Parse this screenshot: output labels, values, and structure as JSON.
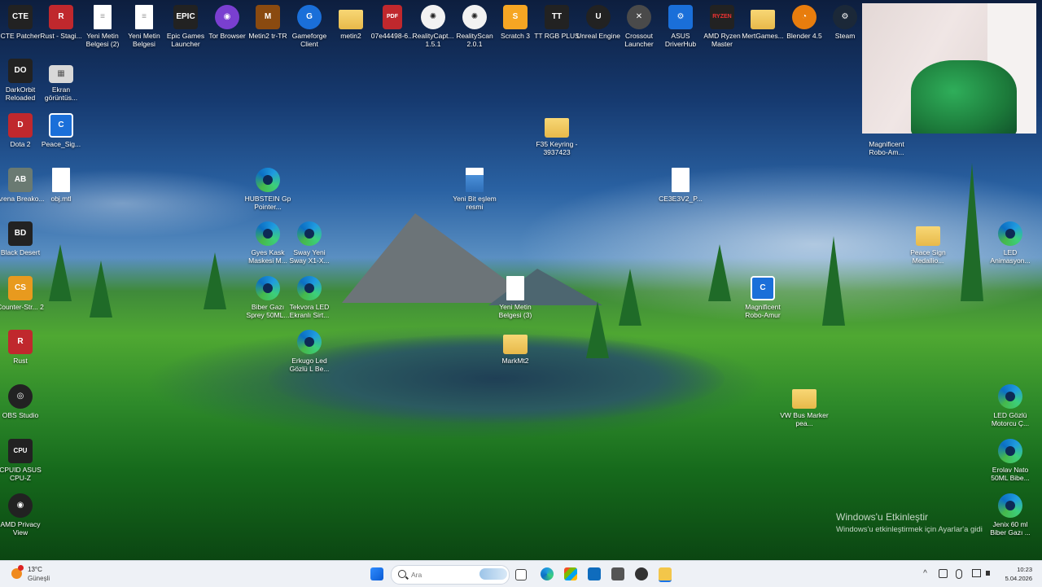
{
  "desktop": {
    "icons_top_row": [
      {
        "label": "CTE Patcher",
        "icon": "cte-patcher-icon",
        "glyph": "CTE"
      },
      {
        "label": "Rust - Stagi...",
        "icon": "rust-icon",
        "glyph": "R"
      },
      {
        "label": "Yeni Metin Belgesi (2)",
        "icon": "text-file-icon",
        "glyph": "≡"
      },
      {
        "label": "Yeni Metin Belgesi",
        "icon": "text-file-icon",
        "glyph": "≡"
      },
      {
        "label": "Epic Games Launcher",
        "icon": "epic-games-icon",
        "glyph": "EPIC"
      },
      {
        "label": "Tor Browser",
        "icon": "tor-browser-icon",
        "glyph": "◉"
      },
      {
        "label": "Metin2 tr-TR",
        "icon": "metin2-icon",
        "glyph": "M"
      },
      {
        "label": "Gameforge Client",
        "icon": "gameforge-icon",
        "glyph": "G"
      },
      {
        "label": "metin2",
        "icon": "folder-icon",
        "glyph": ""
      },
      {
        "label": "07e44498-6...",
        "icon": "pdf-icon",
        "glyph": "PDF"
      },
      {
        "label": "RealityCapt... 1.5.1",
        "icon": "realitycapture-icon",
        "glyph": "✺"
      },
      {
        "label": "RealityScan 2.0.1",
        "icon": "realityscan-icon",
        "glyph": "✺"
      },
      {
        "label": "Scratch 3",
        "icon": "scratch-icon",
        "glyph": "S"
      },
      {
        "label": "TT RGB PLUS",
        "icon": "tt-rgb-icon",
        "glyph": "TT"
      },
      {
        "label": "Unreal Engine",
        "icon": "unreal-engine-icon",
        "glyph": "U"
      },
      {
        "label": "Crossout Launcher",
        "icon": "crossout-icon",
        "glyph": "✕"
      },
      {
        "label": "ASUS DriverHub",
        "icon": "asus-driverhub-icon",
        "glyph": "⚙"
      },
      {
        "label": "AMD Ryzen Master",
        "icon": "amd-ryzen-icon",
        "glyph": "RYZEN"
      },
      {
        "label": "MertGames...",
        "icon": "folder-icon",
        "glyph": ""
      },
      {
        "label": "Blender 4.5",
        "icon": "blender-icon",
        "glyph": "◔"
      },
      {
        "label": "Steam",
        "icon": "steam-icon",
        "glyph": "⚙"
      }
    ],
    "icons_left_col": [
      {
        "label": "DarkOrbit Reloaded",
        "icon": "darkorbit-icon",
        "glyph": "DO"
      },
      {
        "label": "Dota 2",
        "icon": "dota2-icon",
        "glyph": "D"
      },
      {
        "label": "Arena Breako...",
        "icon": "arena-breakout-icon",
        "glyph": "AB"
      },
      {
        "label": "Black Desert",
        "icon": "black-desert-icon",
        "glyph": "BD"
      },
      {
        "label": "Counter-Str... 2",
        "icon": "counter-strike-icon",
        "glyph": "CS"
      },
      {
        "label": "Rust",
        "icon": "rust-icon",
        "glyph": "R"
      },
      {
        "label": "OBS Studio",
        "icon": "obs-studio-icon",
        "glyph": "◎"
      },
      {
        "label": "CPUID ASUS CPU-Z",
        "icon": "cpu-z-icon",
        "glyph": "CPU"
      },
      {
        "label": "AMD Privacy View",
        "icon": "amd-privacy-icon",
        "glyph": "◉"
      }
    ],
    "icons_second_col": [
      {
        "label": "Ekran görüntüs...",
        "icon": "screenshot-icon",
        "glyph": "▦"
      },
      {
        "label": "Peace_Sig...",
        "icon": "app-c-icon",
        "glyph": "C"
      },
      {
        "label": "obj.mtl",
        "icon": "file-icon",
        "glyph": ""
      }
    ],
    "icons_middle": [
      {
        "label": "HUBSTEIN Gp Pointer...",
        "icon": "edge-icon"
      },
      {
        "label": "Gyes Kask Maskesi M...",
        "icon": "edge-icon"
      },
      {
        "label": "Sway Yeni Sway X1-X...",
        "icon": "edge-icon"
      },
      {
        "label": "Biber Gazı Sprey 50ML...",
        "icon": "edge-icon"
      },
      {
        "label": "Tekvora LED Ekranlı Sirt...",
        "icon": "edge-icon"
      },
      {
        "label": "Erkugo Led Gözlü L Be...",
        "icon": "edge-icon"
      },
      {
        "label": "Yeni Bit eşlem resmi",
        "icon": "bitmap-file-icon"
      },
      {
        "label": "Yeni Metin Belgesi (3)",
        "icon": "text-file-icon"
      },
      {
        "label": "MarkMt2",
        "icon": "folder-icon"
      },
      {
        "label": "F35 Keyring - 3937423",
        "icon": "folder-icon"
      },
      {
        "label": "CE3E3V2_P...",
        "icon": "file-icon"
      },
      {
        "label": "Magnificent Robo-Amur",
        "icon": "app-c-icon"
      },
      {
        "label": "VW Bus Marker pea...",
        "icon": "folder-icon"
      }
    ],
    "icons_right_col": [
      {
        "label": "Magnificent Robo-Am...",
        "icon": "app-c-icon"
      },
      {
        "label": "Peace Sign Medallio...",
        "icon": "folder-icon"
      },
      {
        "label": "LED Animasyon...",
        "icon": "edge-icon"
      },
      {
        "label": "LED Gözlü Motorcu Ç...",
        "icon": "edge-icon"
      },
      {
        "label": "Erolav Nato 50ML Bibe...",
        "icon": "edge-icon"
      },
      {
        "label": "Jenix 60 ml Biber Gazı ...",
        "icon": "edge-icon"
      }
    ],
    "watermark": {
      "title": "Windows'u Etkinleştir",
      "subtitle": "Windows'u etkinleştirmek için Ayarlar'a gidi"
    }
  },
  "taskbar": {
    "weather": {
      "temp": "13°C",
      "condition": "Güneşli"
    },
    "search": {
      "placeholder": "Ara"
    },
    "pinned": [
      {
        "name": "start-button",
        "color": "#1a73e8"
      },
      {
        "name": "task-view-button",
        "color": "#333333"
      },
      {
        "name": "edge-taskbar-button",
        "color": "#1f9be0"
      },
      {
        "name": "store-taskbar-button",
        "color": "#3a7bd5"
      },
      {
        "name": "outlook-taskbar-button",
        "color": "#0f6cbd"
      },
      {
        "name": "app-taskbar-button",
        "color": "#555555"
      },
      {
        "name": "chrome-taskbar-button",
        "color": "#333333"
      },
      {
        "name": "file-explorer-taskbar-button",
        "color": "#f3c64a"
      }
    ],
    "tray": {
      "chevron": "^",
      "time": "10:23",
      "date": "5.04.2026"
    }
  }
}
